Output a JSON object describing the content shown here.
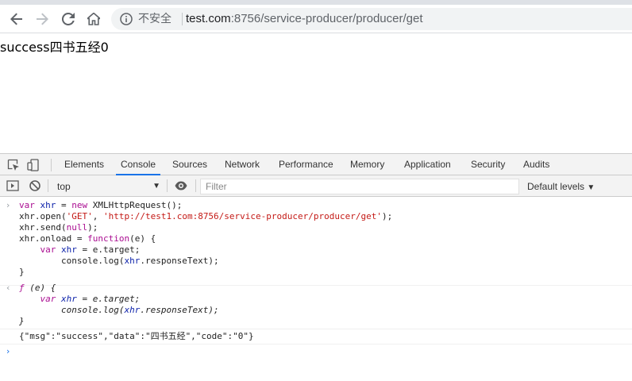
{
  "browser": {
    "security_label": "不安全",
    "url_host": "test.com",
    "url_rest": ":8756/service-producer/producer/get"
  },
  "page": {
    "body_text": "success四书五经0"
  },
  "devtools": {
    "tabs": [
      "Elements",
      "Console",
      "Sources",
      "Network",
      "Performance",
      "Memory",
      "Application",
      "Security",
      "Audits"
    ],
    "active_tab": "Console",
    "context": "top",
    "filter_placeholder": "Filter",
    "levels": "Default levels"
  },
  "console": {
    "input_lines": [
      "var xhr = new XMLHttpRequest();",
      "xhr.open('GET', 'http://test1.com:8756/service-producer/producer/get');",
      "xhr.send(null);",
      "xhr.onload = function(e) {",
      "    var xhr = e.target;",
      "        console.log(xhr.responseText);",
      "}"
    ],
    "result_lines": [
      "ƒ (e) {",
      "    var xhr = e.target;",
      "        console.log(xhr.responseText);",
      "}"
    ],
    "log_line": "{\"msg\":\"success\",\"data\":\"四书五经\",\"code\":\"0\"}"
  }
}
